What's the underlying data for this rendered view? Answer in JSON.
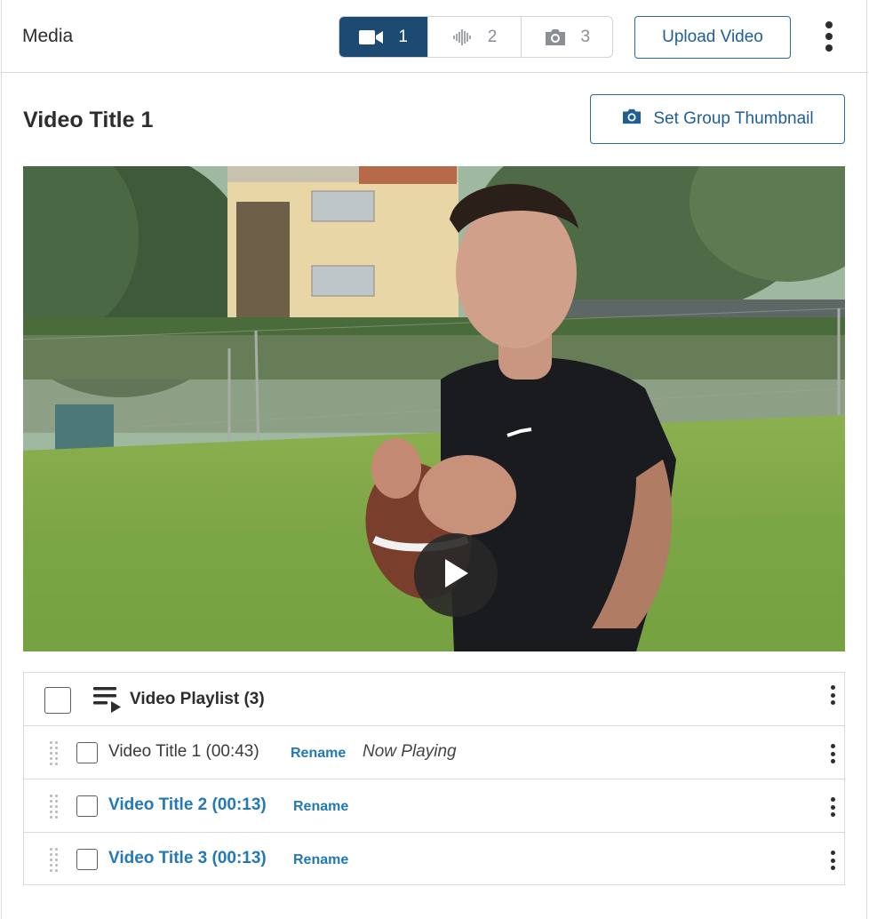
{
  "header": {
    "title": "Media",
    "media_tabs": [
      {
        "icon": "video-camera-icon",
        "count": "1",
        "active": true
      },
      {
        "icon": "audio-wave-icon",
        "count": "2",
        "active": false
      },
      {
        "icon": "camera-icon",
        "count": "3",
        "active": false
      }
    ],
    "upload_label": "Upload Video",
    "more_icon": "vertical-ellipsis-icon"
  },
  "main": {
    "video_title": "Video Title 1",
    "thumbnail_button": {
      "icon": "camera-icon",
      "label": "Set Group Thumbnail"
    },
    "player": {
      "play_icon": "play-icon"
    }
  },
  "playlist": {
    "header_label": "Video Playlist (3)",
    "header_icon": "playlist-play-icon",
    "items": [
      {
        "title": "Video Title 1 (00:43)",
        "rename_label": "Rename",
        "status": "Now Playing",
        "is_link": false
      },
      {
        "title": "Video Title 2 (00:13)",
        "rename_label": "Rename",
        "status": "",
        "is_link": true
      },
      {
        "title": "Video Title 3 (00:13)",
        "rename_label": "Rename",
        "status": "",
        "is_link": true
      }
    ]
  },
  "colors": {
    "active_tab": "#1c4a73",
    "link_blue": "#2378b8",
    "button_border": "#2a6aa3"
  }
}
